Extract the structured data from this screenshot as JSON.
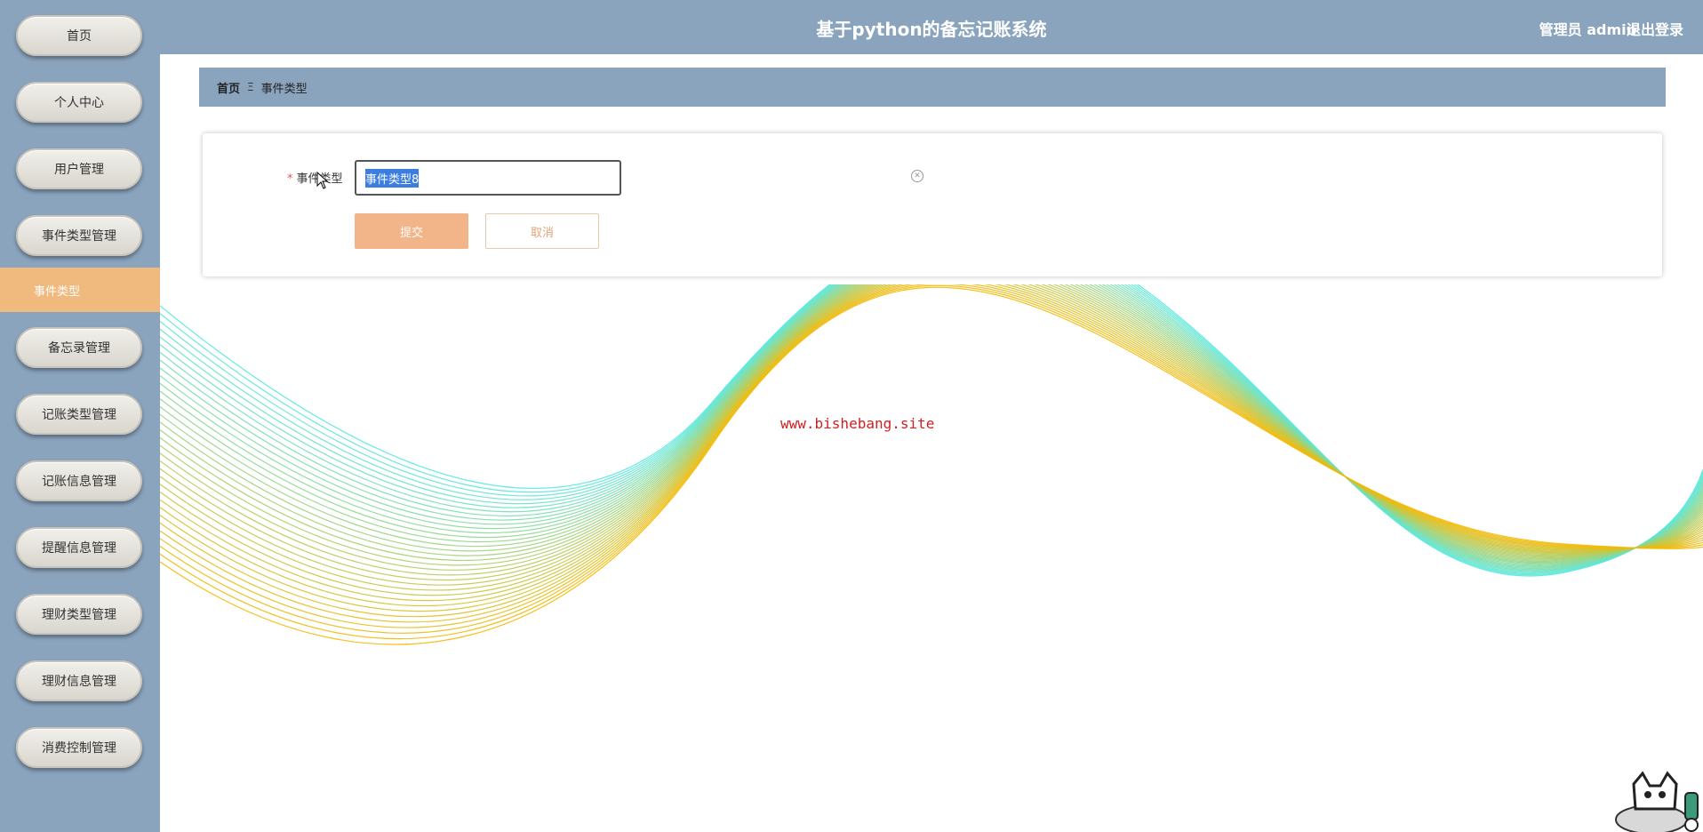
{
  "header": {
    "title": "基于python的备忘记账系统",
    "user": "管理员 admin",
    "logout": "退出登录"
  },
  "sidebar": {
    "items": [
      {
        "label": "首页"
      },
      {
        "label": "个人中心"
      },
      {
        "label": "用户管理"
      },
      {
        "label": "事件类型管理"
      },
      {
        "label": "备忘录管理"
      },
      {
        "label": "记账类型管理"
      },
      {
        "label": "记账信息管理"
      },
      {
        "label": "提醒信息管理"
      },
      {
        "label": "理财类型管理"
      },
      {
        "label": "理财信息管理"
      },
      {
        "label": "消费控制管理"
      }
    ],
    "active_sub": "事件类型"
  },
  "breadcrumb": {
    "home": "首页",
    "separator": "Ξ",
    "current": "事件类型"
  },
  "form": {
    "label": "事件类型",
    "required_mark": "*",
    "value": "事件类型8",
    "submit": "提交",
    "cancel": "取消"
  },
  "watermark": "www.bishebang.site",
  "colors": {
    "theme": "#8aa4be",
    "active": "#f0b97e",
    "submit": "#f2b58a",
    "wave_cyan": "#55e8e0",
    "wave_yellow": "#f5b800"
  }
}
